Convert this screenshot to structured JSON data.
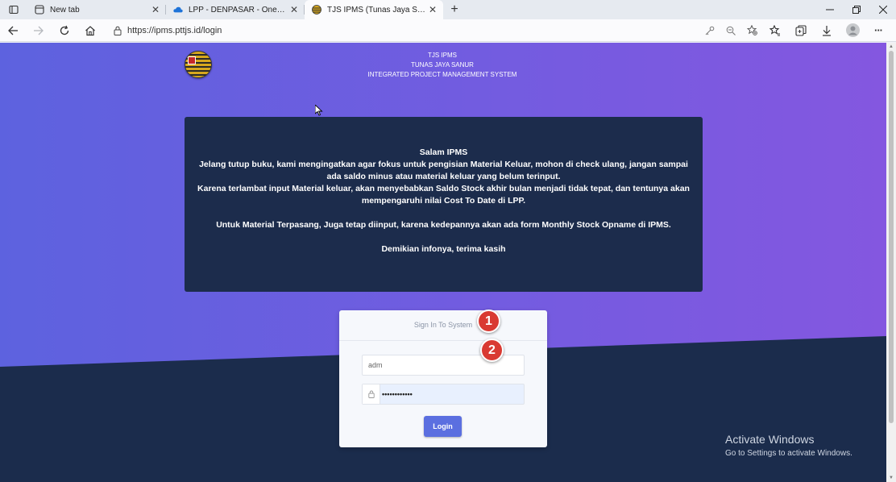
{
  "browser": {
    "tabs": [
      {
        "title": "New tab",
        "icon": "new-tab-page-icon",
        "active": false
      },
      {
        "title": "LPP - DENPASAR - OneDrive",
        "icon": "onedrive-cloud-icon",
        "active": false
      },
      {
        "title": "TJS IPMS (Tunas Jaya Sanur Integrated Project Management System)",
        "icon": "tjs-logo-icon",
        "active": true
      }
    ],
    "new_tab_symbol": "+",
    "url": "https://ipms.pttjs.id/login",
    "menu_symbol": "···"
  },
  "header": {
    "line1": "TJS IPMS",
    "line2": "TUNAS JAYA SANUR",
    "line3": "INTEGRATED PROJECT MANAGEMENT SYSTEM"
  },
  "notice": {
    "title": "Salam IPMS",
    "para1": "Jelang tutup buku, kami mengingatkan agar fokus untuk pengisian Material Keluar, mohon di check ulang, jangan sampai ada saldo minus atau material keluar yang belum terinput.",
    "para2": "Karena terlambat input Material keluar, akan menyebabkan Saldo Stock akhir bulan menjadi tidak tepat, dan tentunya akan mempengaruhi nilai Cost To Date di LPP.",
    "para3": "Untuk Material Terpasang, Juga tetap diinput, karena kedepannya akan ada form Monthly Stock Opname di IPMS.",
    "closing": "Demikian infonya, terima kasih"
  },
  "login": {
    "title": "Sign In To System",
    "username_value": "adm",
    "password_masked": "••••••••••••",
    "button_label": "Login"
  },
  "annotations": {
    "badge1": "1",
    "badge2": "2"
  },
  "watermark": {
    "line1": "Activate Windows",
    "line2": "Go to Settings to activate Windows."
  },
  "colors": {
    "bg_gradient_start": "#5d62df",
    "bg_gradient_end": "#8457e0",
    "bg_dark": "#1b2c4c",
    "notice_bg": "#1c2c4c",
    "button": "#5b6fe0",
    "badge": "#d93a32"
  }
}
